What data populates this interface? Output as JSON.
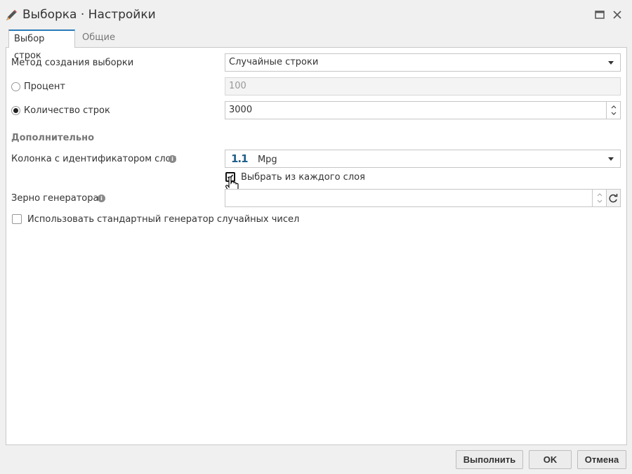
{
  "window": {
    "title": "Выборка · Настройки"
  },
  "tabs": [
    {
      "label": "Выбор строк"
    },
    {
      "label": "Общие"
    }
  ],
  "form": {
    "method": {
      "label": "Метод создания выборки",
      "value": "Случайные строки"
    },
    "percent": {
      "label": "Процент",
      "value": "100"
    },
    "row_count": {
      "label": "Количество строк",
      "value": "3000"
    },
    "advanced_heading": "Дополнительно",
    "strata_column": {
      "label": "Колонка с идентификатором слоя",
      "value": "Mpg",
      "type_glyph": "1.1"
    },
    "sample_each_stratum": {
      "label": "Выбрать из каждого слоя"
    },
    "seed": {
      "label": "Зерно генератора",
      "value": ""
    },
    "use_default_rng": {
      "label": "Использовать стандартный генератор случайных чисел"
    }
  },
  "buttons": {
    "run": "Выполнить",
    "ok": "OK",
    "cancel": "Отмена"
  },
  "colors": {
    "accent": "#2b7bb9"
  }
}
